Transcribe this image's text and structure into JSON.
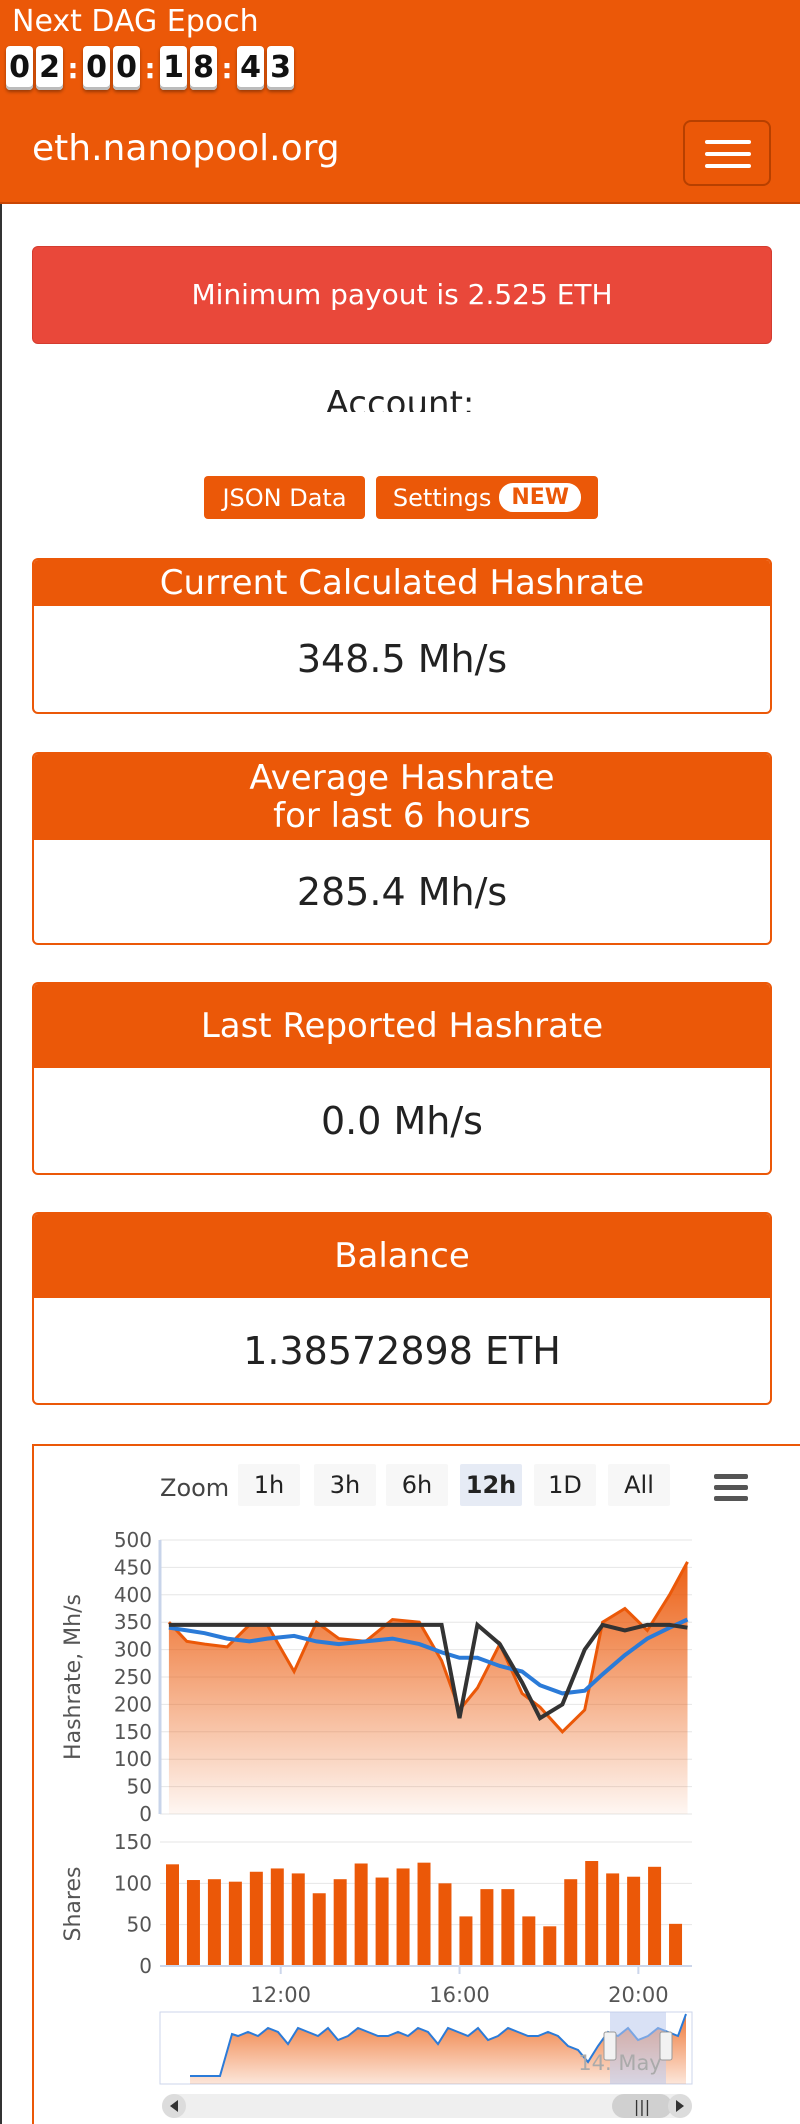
{
  "header": {
    "epoch_title": "Next DAG Epoch",
    "countdown": [
      "0",
      "2",
      ":",
      "0",
      "0",
      ":",
      "1",
      "8",
      ":",
      "4",
      "3"
    ],
    "brand": "eth.nanopool.org",
    "menu_icon": "hamburger-icon"
  },
  "alert": {
    "text": "Minimum payout is 2.525 ETH"
  },
  "account": {
    "label": "Account:"
  },
  "buttons": {
    "json": "JSON Data",
    "settings": "Settings",
    "settings_badge": "NEW"
  },
  "cards": {
    "current": {
      "title": "Current Calculated Hashrate",
      "value": "348.5 Mh/s"
    },
    "average": {
      "title_line1": "Average Hashrate",
      "title_line2": "for last 6 hours",
      "value": "285.4 Mh/s"
    },
    "reported": {
      "title": "Last Reported Hashrate",
      "value": "0.0 Mh/s"
    },
    "balance": {
      "title": "Balance",
      "value": "1.38572898 ETH"
    }
  },
  "chart": {
    "zoom_label": "Zoom",
    "zoom_options": [
      "1h",
      "3h",
      "6h",
      "12h",
      "1D",
      "All"
    ],
    "zoom_selected": "12h",
    "navigator_label": "14. May",
    "colors": {
      "accent": "#eb5808",
      "blue": "#2b7bd8",
      "black": "#333333",
      "grid": "#e6e6e6"
    }
  },
  "chart_data": [
    {
      "type": "line",
      "ylabel": "Hashrate, Mh/s",
      "ylim": [
        0,
        500
      ],
      "yticks": [
        0,
        50,
        100,
        150,
        200,
        250,
        300,
        350,
        400,
        450,
        500
      ],
      "xticks": [
        "12:00",
        "16:00",
        "20:00"
      ],
      "x": [
        9.5,
        9.9,
        10.3,
        10.8,
        11.3,
        11.7,
        12.3,
        12.8,
        13.3,
        13.9,
        14.5,
        15.1,
        15.6,
        16.0,
        16.4,
        16.9,
        17.4,
        17.8,
        18.3,
        18.8,
        19.2,
        19.7,
        20.2,
        20.7,
        21.1
      ],
      "series": [
        {
          "values": [
            350,
            315,
            310,
            305,
            345,
            345,
            260,
            350,
            320,
            315,
            355,
            350,
            280,
            190,
            230,
            310,
            220,
            195,
            150,
            190,
            350,
            375,
            335,
            400,
            460
          ]
        },
        {
          "values": [
            340,
            335,
            330,
            320,
            315,
            320,
            325,
            315,
            310,
            315,
            320,
            310,
            295,
            285,
            285,
            270,
            260,
            235,
            220,
            225,
            255,
            290,
            320,
            340,
            355
          ]
        },
        {
          "values": [
            345,
            345,
            345,
            345,
            345,
            345,
            345,
            345,
            345,
            345,
            345,
            345,
            345,
            175,
            345,
            310,
            240,
            175,
            200,
            300,
            345,
            335,
            345,
            345,
            340
          ]
        }
      ]
    },
    {
      "type": "bar",
      "ylabel": "Shares",
      "ylim": [
        0,
        150
      ],
      "yticks": [
        0,
        50,
        100,
        150
      ],
      "values": [
        123,
        104,
        105,
        102,
        114,
        118,
        112,
        88,
        105,
        124,
        107,
        118,
        125,
        100,
        60,
        93,
        93,
        60,
        48,
        105,
        127,
        112,
        108,
        120,
        51
      ]
    }
  ]
}
